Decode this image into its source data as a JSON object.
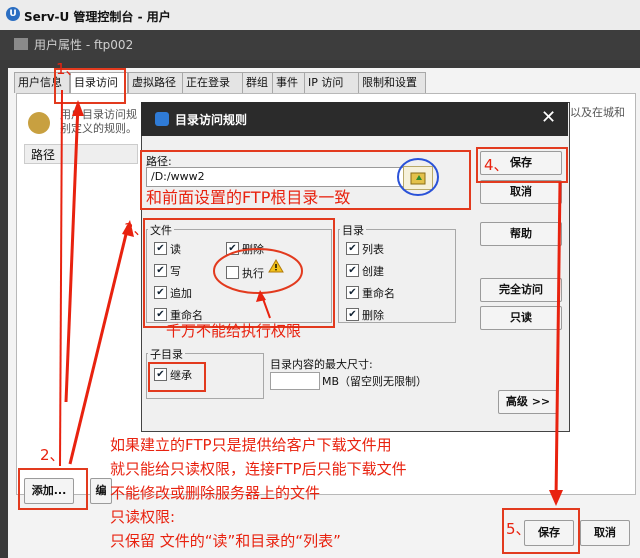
{
  "window": {
    "title": "Serv-U 管理控制台 - 用户"
  },
  "user_properties": {
    "title": "用户属性 - ftp002"
  },
  "tabs": [
    "用户信息",
    "目录访问",
    "虚拟路径",
    "正在登录",
    "群组",
    "事件",
    "IP 访问",
    "限制和设置"
  ],
  "info": {
    "line1": "用户目录访问规",
    "line2": "别定义的规则。",
    "right": "以及在城和"
  },
  "table_header": {
    "path": "路径"
  },
  "bottom_buttons": {
    "add": "添加...",
    "edit": "编",
    "save": "保存",
    "cancel": "取消"
  },
  "dialog": {
    "title": "目录访问规则",
    "close": "✕",
    "path_label": "路径:",
    "path_value": "/D:/www2",
    "file_group": "文件",
    "file_read": "读",
    "file_write": "写",
    "file_append": "追加",
    "file_rename": "重命名",
    "file_delete": "删除",
    "file_execute": "执行",
    "dir_group": "目录",
    "dir_list": "列表",
    "dir_create": "创建",
    "dir_rename": "重命名",
    "dir_delete": "删除",
    "subdir_group": "子目录",
    "subdir_inherit": "继承",
    "max_size_label": "目录内容的最大尺寸:",
    "max_size_unit": "MB（留空则无限制）",
    "save": "保存",
    "cancel": "取消",
    "help": "帮助",
    "full_access": "完全访问",
    "read_only": "只读",
    "advanced": "高级 >>"
  },
  "annotations": {
    "n1": "1、",
    "n2": "2、",
    "n3": "3、",
    "n4": "4、",
    "n5": "5、",
    "path_note": "和前面设置的FTP根目录一致",
    "exec_note": "千万不能给执行权限",
    "bottom1": "如果建立的FTP只是提供给客户下载文件用",
    "bottom2": "就只能给只读权限，连接FTP后只能下载文件",
    "bottom3": "不能修改或删除服务器上的文件",
    "bottom4": "只读权限:",
    "bottom5": "只保留 文件的“读”和目录的“列表”"
  }
}
